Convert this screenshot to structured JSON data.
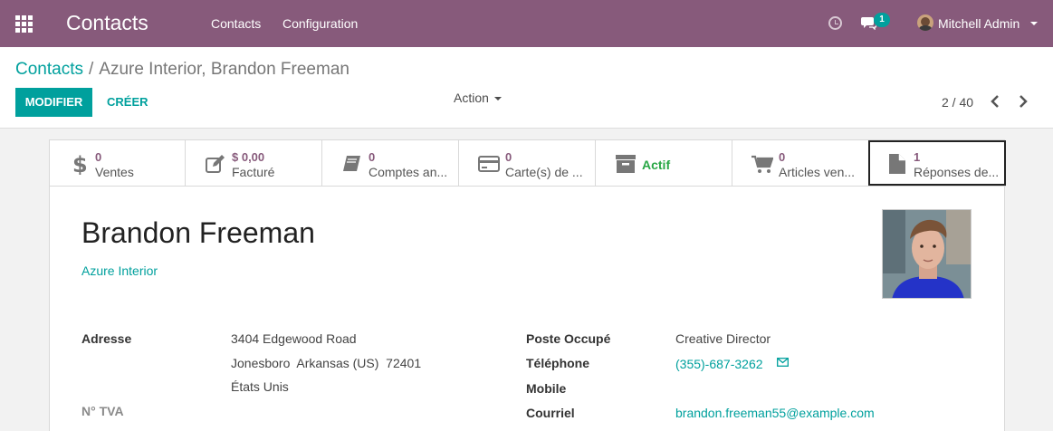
{
  "navbar": {
    "app_title": "Contacts",
    "menu": [
      "Contacts",
      "Configuration"
    ],
    "chat_badge": "1",
    "user_name": "Mitchell Admin",
    "background_color": "#875a7b"
  },
  "breadcrumb": {
    "parent": "Contacts",
    "separator": "/",
    "current": "Azure Interior, Brandon Freeman"
  },
  "toolbar": {
    "edit_label": "MODIFIER",
    "create_label": "CRÉER",
    "action_label": "Action",
    "pager": "2 / 40"
  },
  "smart_buttons": [
    {
      "icon": "dollar-icon",
      "value": "0",
      "label": "Ventes"
    },
    {
      "icon": "edit-icon",
      "value": "$ 0,00",
      "label": "Facturé"
    },
    {
      "icon": "book-icon",
      "value": "0",
      "label": "Comptes an..."
    },
    {
      "icon": "credit-card-icon",
      "value": "0",
      "label": "Carte(s) de ..."
    },
    {
      "icon": "archive-icon",
      "label": "Actif"
    },
    {
      "icon": "shopping-cart-icon",
      "value": "0",
      "label": "Articles ven..."
    },
    {
      "icon": "file-icon",
      "value": "1",
      "label": "Réponses de..."
    }
  ],
  "partner": {
    "name": "Brandon Freeman",
    "company": "Azure Interior"
  },
  "fields": {
    "address_label": "Adresse",
    "street": "3404 Edgewood Road",
    "city_line": "Jonesboro  Arkansas (US)  72401",
    "country": "États Unis",
    "vat_label": "N° TVA",
    "function_label": "Poste Occupé",
    "function": "Creative Director",
    "phone_label": "Téléphone",
    "phone": "(355)-687-3262",
    "mobile_label": "Mobile",
    "email_label": "Courriel",
    "email": "brandon.freeman55@example.com"
  },
  "colors": {
    "accent": "#00a09d",
    "stat_value": "#875a7b",
    "active": "#28a745"
  }
}
